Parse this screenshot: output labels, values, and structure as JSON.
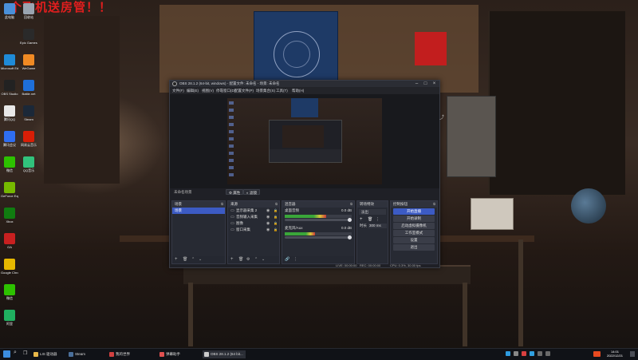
{
  "overlay_text": "个飞机送房管！！",
  "desktop_icons": [
    {
      "label": "此电脑",
      "icon": "computer-icon",
      "color": "#4a90d9"
    },
    {
      "label": "回收站",
      "icon": "recycle-bin-icon",
      "color": "#9aa5b1"
    },
    {
      "label": "Epic Games Launcher",
      "icon": "epic-games-icon",
      "color": "#2a2a2a"
    },
    {
      "label": "Microsoft Edge",
      "icon": "edge-icon",
      "color": "#1f8bd8"
    },
    {
      "label": "WeGame",
      "icon": "wegame-icon",
      "color": "#f08a24"
    },
    {
      "label": "OBS Studio",
      "icon": "obs-icon",
      "color": "#222222"
    },
    {
      "label": "Battle.net",
      "icon": "battlenet-icon",
      "color": "#1e6fd9"
    },
    {
      "label": "腾讯QQ",
      "icon": "qq-icon",
      "color": "#e8e8e8"
    },
    {
      "label": "Steam",
      "icon": "steam-icon",
      "color": "#1b2838"
    },
    {
      "label": "腾讯会议",
      "icon": "meeting-icon",
      "color": "#2f6ef0"
    },
    {
      "label": "网易云音乐",
      "icon": "netease-music-icon",
      "color": "#d81e06"
    },
    {
      "label": "微信",
      "icon": "wechat-icon",
      "color": "#2dc100"
    },
    {
      "label": "QQ音乐",
      "icon": "qqmusic-icon",
      "color": "#31c27c"
    },
    {
      "label": "GeForce Experience",
      "icon": "nvidia-icon",
      "color": "#76b900"
    },
    {
      "label": "Xbox",
      "icon": "xbox-icon",
      "color": "#107c10"
    },
    {
      "label": "GA",
      "icon": "ga-icon",
      "color": "#c82020"
    },
    {
      "label": "Google Chrome",
      "icon": "chrome-icon",
      "color": "#e6b800"
    },
    {
      "label": "微信",
      "icon": "wechat-icon-2",
      "color": "#2dc100"
    },
    {
      "label": "阿里",
      "icon": "app-icon",
      "color": "#20b060"
    }
  ],
  "obs": {
    "title": "OBS 28.1.2 (64-bit, windows) - 配置文件: 未命名 - 场景: 未命名",
    "menu": [
      "文件(F)",
      "编辑(E)",
      "视图(V)",
      "停靠窗口(D)",
      "配置文件(P)",
      "场景集合(S)",
      "工具(T)",
      "帮助(H)"
    ],
    "scene_name": "未命名场景",
    "toolbar": {
      "properties": "属性",
      "filters": "滤镜"
    },
    "scenes": {
      "title": "场景",
      "items": [
        "场景"
      ]
    },
    "sources": {
      "title": "来源",
      "items": [
        "显示器采集 2",
        "音频输入采集",
        "图像",
        "窗口采集"
      ]
    },
    "mixer": {
      "title": "混音器",
      "channels": [
        {
          "name": "桌面音频",
          "db": "0.0 dB",
          "level": 0.62
        },
        {
          "name": "麦克风/Aux",
          "db": "0.0 dB",
          "level": 0.45
        }
      ]
    },
    "transitions": {
      "title": "转场特效",
      "type": "淡出",
      "duration_label": "时长",
      "duration": "300 ms"
    },
    "controls": {
      "title": "控制按钮",
      "buttons": [
        "开始直播",
        "开始录制",
        "启动虚拟摄像机",
        "工作室模式",
        "设置",
        "退出"
      ]
    },
    "status": {
      "live": "LIVE: 00:00:00",
      "rec": "REC: 00:00:00",
      "cpu": "CPU: 0.3%, 30.00 fps"
    }
  },
  "taskbar": {
    "apps": [
      {
        "label": "LIS 驱动器",
        "icon": "folder-icon",
        "color": "#e8b84a"
      },
      {
        "label": "Steam",
        "icon": "steam-icon",
        "color": "#4a6f9a"
      },
      {
        "label": "我的世界",
        "icon": "game-icon",
        "color": "#d04040"
      },
      {
        "label": "弹幕助手",
        "icon": "danmaku-icon",
        "color": "#e05050"
      },
      {
        "label": "OBS 28.1.2 (64 bit...",
        "icon": "obs-icon",
        "color": "#cccccc"
      }
    ],
    "time": "14:01",
    "date": "2022/12/21"
  },
  "colors": {
    "accent": "#3c5bc4",
    "overlay": "#e01e1e"
  }
}
